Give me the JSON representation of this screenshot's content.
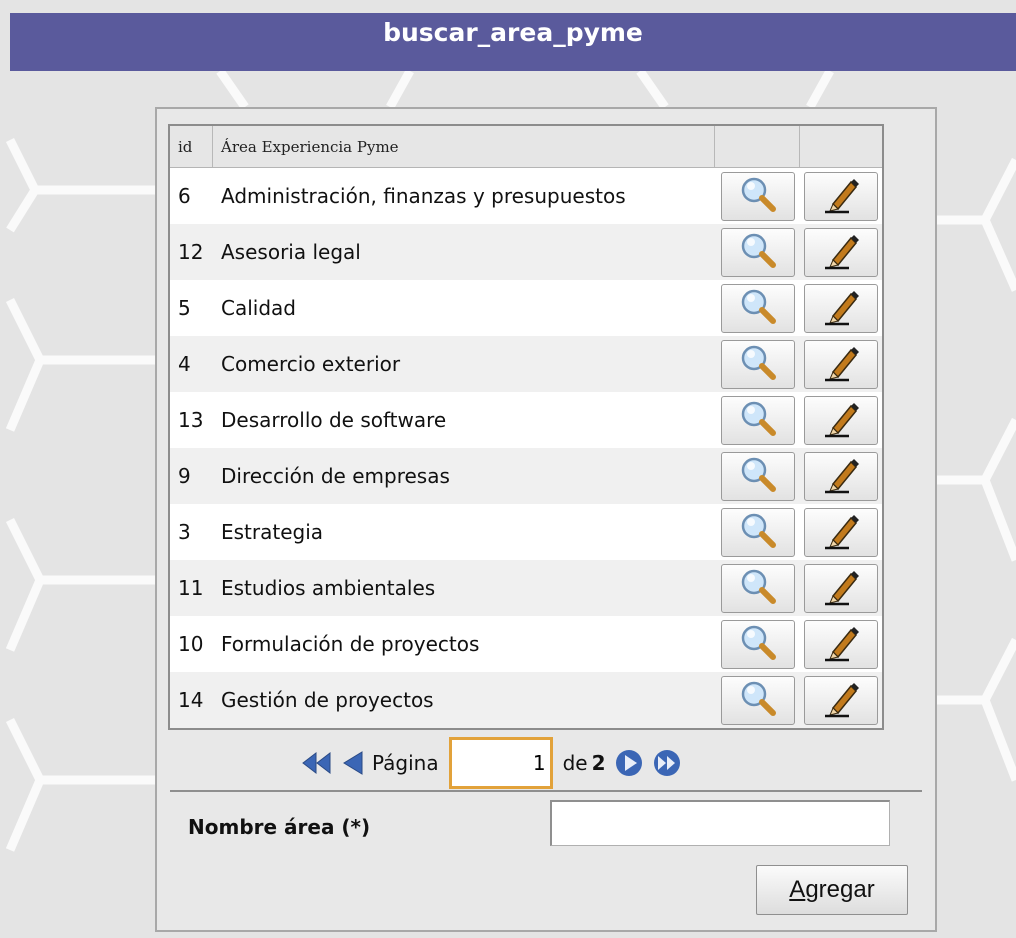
{
  "window": {
    "title": "buscar_area_pyme"
  },
  "grid": {
    "headers": {
      "id": "id",
      "name": "Área Experiencia Pyme",
      "view": "",
      "edit": ""
    },
    "rows": [
      {
        "id": "6",
        "name": "Administración, finanzas y presupuestos"
      },
      {
        "id": "12",
        "name": "Asesoria legal"
      },
      {
        "id": "5",
        "name": "Calidad"
      },
      {
        "id": "4",
        "name": "Comercio exterior"
      },
      {
        "id": "13",
        "name": "Desarrollo de software"
      },
      {
        "id": "9",
        "name": "Dirección de empresas"
      },
      {
        "id": "3",
        "name": "Estrategia"
      },
      {
        "id": "11",
        "name": "Estudios ambientales"
      },
      {
        "id": "10",
        "name": "Formulación de proyectos"
      },
      {
        "id": "14",
        "name": "Gestión de proyectos"
      }
    ],
    "row_icons": {
      "view": "magnifier-icon",
      "edit": "pencil-icon"
    }
  },
  "pager": {
    "label": "Página",
    "current": "1",
    "of_label": "de",
    "total": "2",
    "icons": [
      "first-page-icon",
      "prev-page-icon",
      "next-page-icon",
      "last-page-icon"
    ]
  },
  "form": {
    "label": "Nombre área (*)",
    "name_value": "",
    "submit_label": "Agregar",
    "submit_accesskey": "A"
  },
  "colors": {
    "titlebar": "#5a5a9c",
    "pager_button": "#3b66b5",
    "input_focus": "#e2a23a"
  }
}
